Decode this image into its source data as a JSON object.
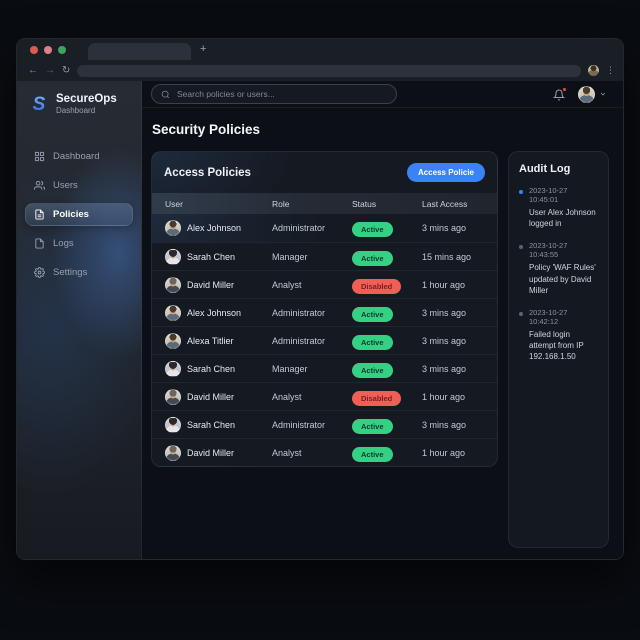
{
  "colors": {
    "accent": "#3b82f6",
    "status_active": "#36d085",
    "status_disabled": "#f05f57",
    "notification_dot": "#ef4444"
  },
  "browser": {
    "traffic_lights": [
      {
        "name": "close",
        "color": "#de5b52"
      },
      {
        "name": "minimize",
        "color": "#de8087"
      },
      {
        "name": "zoom",
        "color": "#3fa364"
      }
    ],
    "tab_title": "",
    "new_tab_label": "+",
    "back_glyph": "←",
    "forward_glyph": "→",
    "reload_glyph": "↻",
    "menu_glyph": "⋮"
  },
  "sidebar": {
    "brand": {
      "logo_letter": "S",
      "name": "SecureOps",
      "subtitle": "Dashboard"
    },
    "items": [
      {
        "label": "Dashboard",
        "icon": "grid-icon",
        "active": false
      },
      {
        "label": "Users",
        "icon": "users-icon",
        "active": false
      },
      {
        "label": "Policies",
        "icon": "document-icon",
        "active": true
      },
      {
        "label": "Logs",
        "icon": "file-icon",
        "active": false
      },
      {
        "label": "Settings",
        "icon": "gear-icon",
        "active": false
      }
    ]
  },
  "topbar": {
    "search_placeholder": "Search policies or users..."
  },
  "main": {
    "page_title": "Security Policies",
    "card": {
      "title": "Access Policies",
      "button_label": "Access Policie",
      "columns": [
        "User",
        "Role",
        "Status",
        "Last Access"
      ],
      "rows": [
        {
          "user": "Alex Johnson",
          "role": "Administrator",
          "status": "Active",
          "last_access": "3 mins ago",
          "avatar": "alex"
        },
        {
          "user": "Sarah Chen",
          "role": "Manager",
          "status": "Active",
          "last_access": "15 mins ago",
          "avatar": "sarah"
        },
        {
          "user": "David Miller",
          "role": "Analyst",
          "status": "Disabled",
          "last_access": "1 hour ago",
          "avatar": "david"
        },
        {
          "user": "Alex Johnson",
          "role": "Administrator",
          "status": "Active",
          "last_access": "3 mins ago",
          "avatar": "alex"
        },
        {
          "user": "Alexa Titlier",
          "role": "Administrator",
          "status": "Active",
          "last_access": "3 mins ago",
          "avatar": "alex"
        },
        {
          "user": "Sarah Chen",
          "role": "Manager",
          "status": "Active",
          "last_access": "3 mins ago",
          "avatar": "sarah"
        },
        {
          "user": "David Miller",
          "role": "Analyst",
          "status": "Disabled",
          "last_access": "1 hour ago",
          "avatar": "david"
        },
        {
          "user": "Sarah Chen",
          "role": "Administrator",
          "status": "Active",
          "last_access": "3 mins ago",
          "avatar": "sarah"
        },
        {
          "user": "David Miller",
          "role": "Analyst",
          "status": "Active",
          "last_access": "1 hour ago",
          "avatar": "david"
        }
      ]
    },
    "audit_log": {
      "title": "Audit Log",
      "entries": [
        {
          "timestamp": "2023-10-27 10:45:01",
          "text": "User Alex Johnson logged in",
          "highlight": true
        },
        {
          "timestamp": "2023-10-27 10:43:55",
          "text": "Policy 'WAF Rules' updated by David Miller",
          "highlight": false
        },
        {
          "timestamp": "2023-10-27 10:42:12",
          "text": "Failed login attempt from IP 192.168.1.50",
          "highlight": false
        }
      ]
    }
  }
}
